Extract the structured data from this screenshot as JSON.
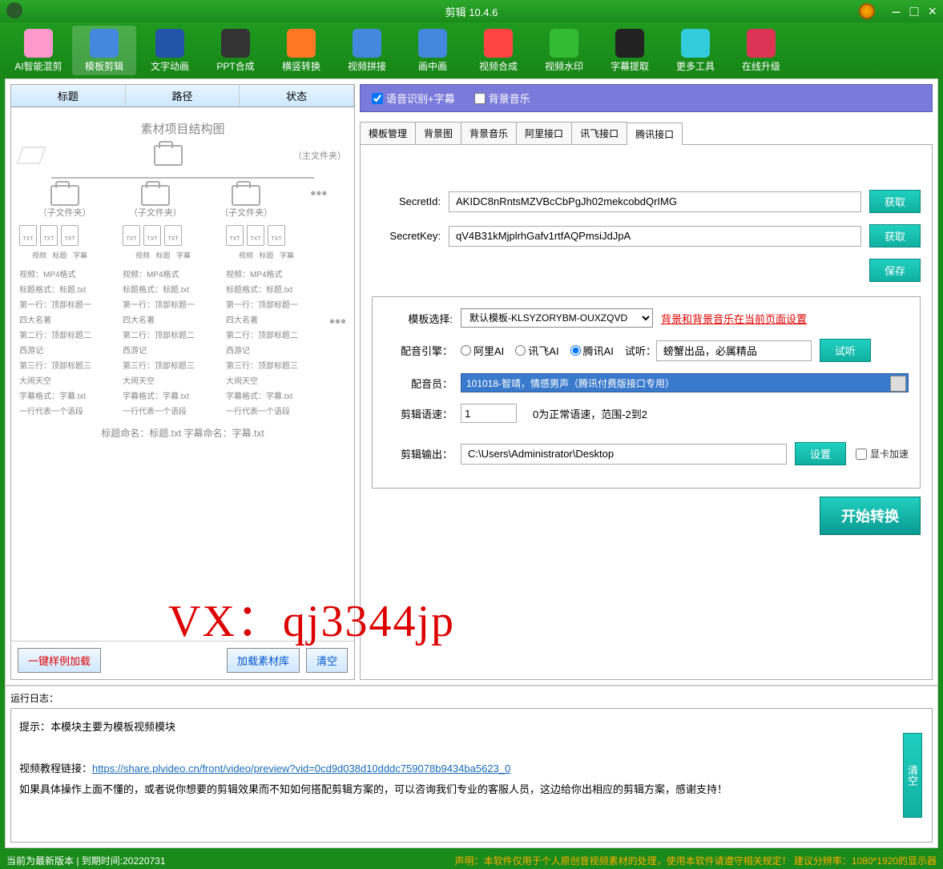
{
  "title": "剪辑 10.4.6",
  "toolbar": [
    {
      "label": "AI智能混剪",
      "color": "#ff99cc"
    },
    {
      "label": "模板剪辑",
      "color": "#4488dd",
      "active": true
    },
    {
      "label": "文字动画",
      "color": "#2255aa"
    },
    {
      "label": "PPT合成",
      "color": "#333"
    },
    {
      "label": "横竖转换",
      "color": "#ff7722"
    },
    {
      "label": "视频拼接",
      "color": "#4488dd"
    },
    {
      "label": "画中画",
      "color": "#4488dd"
    },
    {
      "label": "视频合成",
      "color": "#ff4444"
    },
    {
      "label": "视频水印",
      "color": "#33bb33"
    },
    {
      "label": "字幕提取",
      "color": "#222"
    },
    {
      "label": "更多工具",
      "color": "#33ccdd"
    },
    {
      "label": "在线升级",
      "color": "#dd3355"
    }
  ],
  "left": {
    "headers": [
      "标题",
      "路径",
      "状态"
    ],
    "diagram_title": "素材项目结构图",
    "main_folder": "（主文件夹）",
    "sub_folder": "（子文件夹）",
    "file_types": [
      "视频",
      "标题",
      "字幕"
    ],
    "col_lines": [
      "视频：MP4格式",
      "标题格式：标题.txt",
      "第一行：顶部标题一",
      "四大名著",
      "第二行：顶部标题二",
      "西游记",
      "第三行：顶部标题三",
      "大闹天空",
      "字幕格式：字幕.txt",
      "一行代表一个语段"
    ],
    "bottom_name": "标题命名：标题.txt  字幕命名：字幕.txt",
    "btn_sample": "一键样例加载",
    "btn_load": "加载素材库",
    "btn_clear": "清空"
  },
  "options": {
    "opt1": "语音识别+字幕",
    "opt2": "背景音乐"
  },
  "tabs": [
    "模板管理",
    "背景图",
    "背景音乐",
    "阿里接口",
    "讯飞接口",
    "腾讯接口"
  ],
  "form": {
    "secret_id_label": "SecretId:",
    "secret_id_value": "AKIDC8nRntsMZVBcCbPgJh02mekcobdQrIMG",
    "secret_key_label": "SecretKey:",
    "secret_key_value": "qV4B31kMjplrhGafv1rtfAQPmsiJdJpA",
    "btn_get": "获取",
    "btn_save": "保存"
  },
  "section2": {
    "template_label": "模板选择:",
    "template_value": "默认模板-KLSYZORYBM-OUXZQVD",
    "template_note": "背景和背景音乐在当前页面设置",
    "engine_label": "配音引擎：",
    "engines": [
      "阿里AI",
      "讯飞AI",
      "腾讯AI"
    ],
    "preview_label": "试听：",
    "preview_text": "螃蟹出品，必属精品",
    "btn_preview": "试听",
    "voice_label": "配音员：",
    "voice_value": "101018-智靖，情感男声（腾讯付费版接口专用）",
    "speed_label": "剪辑语速：",
    "speed_value": "1",
    "speed_note": "0为正常语速，范围-2到2",
    "output_label": "剪辑输出：",
    "output_value": "C:\\Users\\Administrator\\Desktop",
    "btn_settings": "设置",
    "chk_gpu": "显卡加速"
  },
  "btn_start": "开始转换",
  "log": {
    "label": "运行日志：",
    "line1": "提示：本模块主要为模板视频模块",
    "line2a": "视频教程链接：",
    "line2b": "https://share.plvideo.cn/front/video/preview?vid=0cd9d038d10dddc759078b9434ba5623_0",
    "line3": "如果具体操作上面不懂的，或者说你想要的剪辑效果而不知如何搭配剪辑方案的，可以咨询我们专业的客服人员，这边给你出相应的剪辑方案，感谢支持！",
    "btn_clear": "清空"
  },
  "watermark": "VX：qj3344jp",
  "status": {
    "left": "当前为最新版本 | 到期时间:20220731",
    "right": "声明：本软件仅用于个人原创音视频素材的处理，使用本软件请遵守相关规定！  建议分辨率：1080*1920的显示器"
  }
}
